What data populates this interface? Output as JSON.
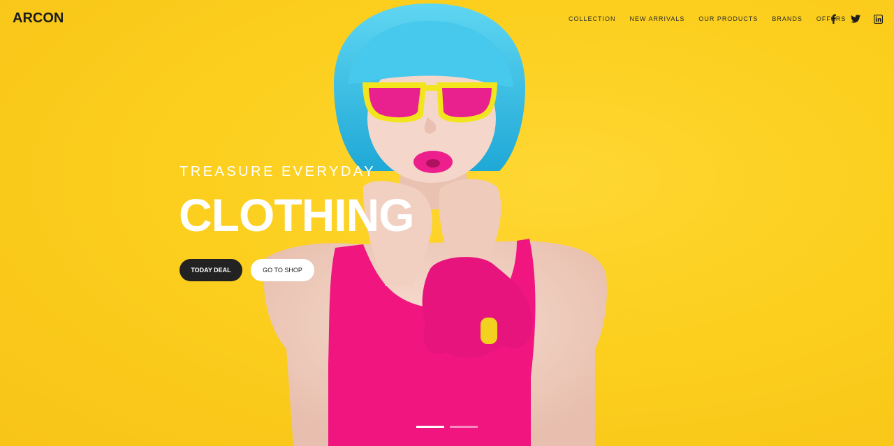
{
  "brand": {
    "logo": "ARCON"
  },
  "nav": {
    "items": [
      "COLLECTION",
      "NEW ARRIVALS",
      "OUR PRODUCTS",
      "BRANDS",
      "OFFERS"
    ]
  },
  "social": {
    "icons": [
      "facebook-icon",
      "twitter-icon",
      "linkedin-icon"
    ]
  },
  "hero": {
    "tagline": "TREASURE EVERYDAY",
    "headline": "CLOTHING",
    "primary_button": "TODAY DEAL",
    "secondary_button": "GO TO SHOP",
    "slide_count": 2,
    "active_slide": 1
  },
  "colors": {
    "background": "#fccf1e",
    "hair": "#35c2e8",
    "glasses_frame": "#f2e51e",
    "lenses": "#e8218f",
    "dress": "#f0157f",
    "skin": "#f3d3c4",
    "button_dark": "#222222"
  }
}
